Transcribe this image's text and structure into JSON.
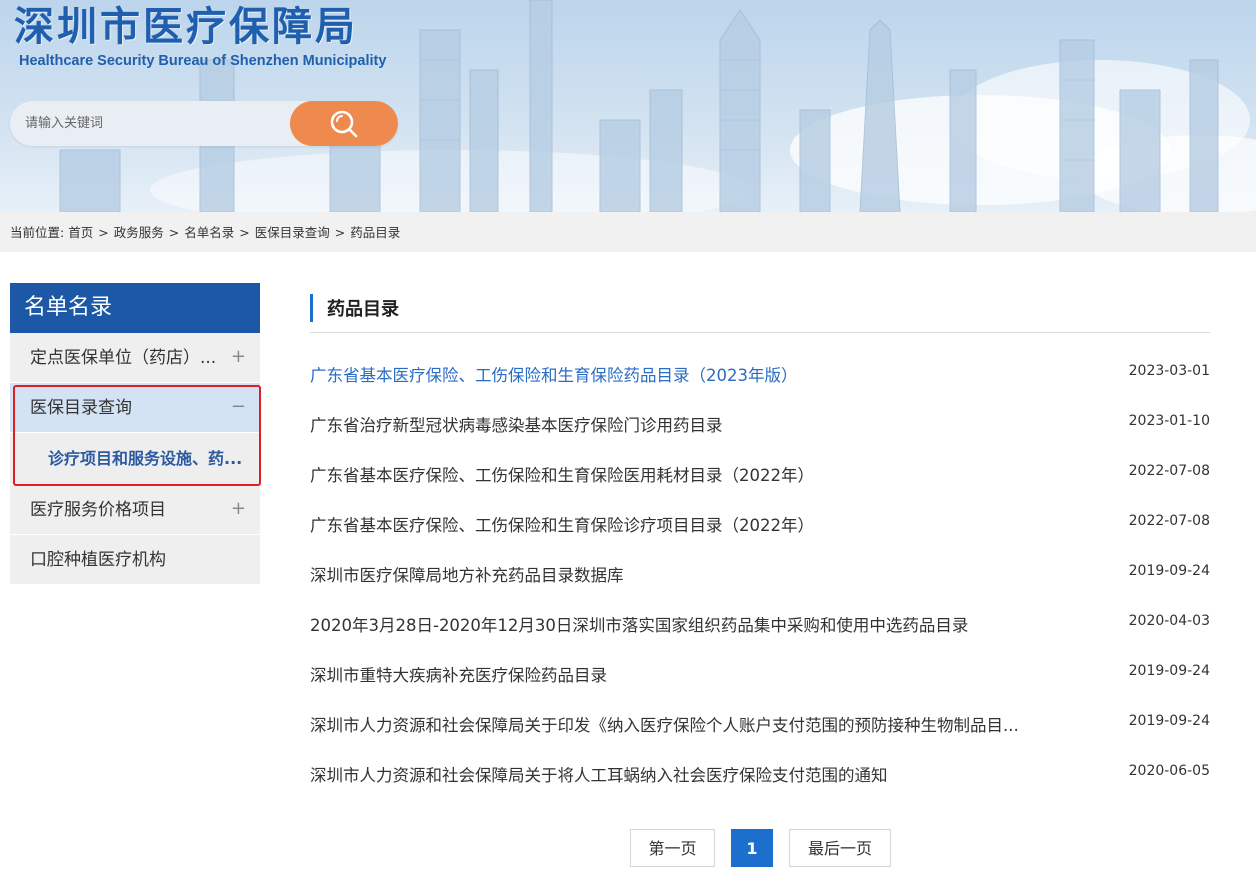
{
  "header": {
    "title_cn": "深圳市医疗保障局",
    "title_en": "Healthcare Security Bureau of Shenzhen Municipality",
    "search": {
      "placeholder": "请输入关键词",
      "button_icon": "search-icon"
    }
  },
  "breadcrumb": {
    "prefix": "当前位置:",
    "items": [
      "首页",
      "政务服务",
      "名单名录",
      "医保目录查询",
      "药品目录"
    ],
    "separator": ">"
  },
  "sidebar": {
    "title": "名单名录",
    "items": [
      {
        "label": "定点医保单位（药店）...",
        "toggle": "+"
      },
      {
        "label": "医保目录查询",
        "toggle": "−",
        "sub": "诊疗项目和服务设施、药..."
      },
      {
        "label": "医疗服务价格项目",
        "toggle": "+"
      },
      {
        "label": "口腔种植医疗机构",
        "toggle": ""
      }
    ]
  },
  "main": {
    "section_title": "药品目录",
    "items": [
      {
        "title": "广东省基本医疗保险、工伤保险和生育保险药品目录（2023年版）",
        "date": "2023-03-01"
      },
      {
        "title": "广东省治疗新型冠状病毒感染基本医疗保险门诊用药目录",
        "date": "2023-01-10"
      },
      {
        "title": "广东省基本医疗保险、工伤保险和生育保险医用耗材目录（2022年）",
        "date": "2022-07-08"
      },
      {
        "title": "广东省基本医疗保险、工伤保险和生育保险诊疗项目目录（2022年）",
        "date": "2022-07-08"
      },
      {
        "title": "深圳市医疗保障局地方补充药品目录数据库",
        "date": "2019-09-24"
      },
      {
        "title": "2020年3月28日-2020年12月30日深圳市落实国家组织药品集中采购和使用中选药品目录",
        "date": "2020-04-03"
      },
      {
        "title": "深圳市重特大疾病补充医疗保险药品目录",
        "date": "2019-09-24"
      },
      {
        "title": "深圳市人力资源和社会保障局关于印发《纳入医疗保险个人账户支付范围的预防接种生物制品目...",
        "date": "2019-09-24"
      },
      {
        "title": "深圳市人力资源和社会保障局关于将人工耳蜗纳入社会医疗保险支付范围的通知",
        "date": "2020-06-05"
      }
    ]
  },
  "pagination": {
    "first": "第一页",
    "current": "1",
    "last": "最后一页"
  },
  "colors": {
    "brand_blue": "#1d58a6",
    "link_blue": "#2a6cc4",
    "search_orange": "#ee8a4d",
    "highlight_red": "#e02020"
  }
}
